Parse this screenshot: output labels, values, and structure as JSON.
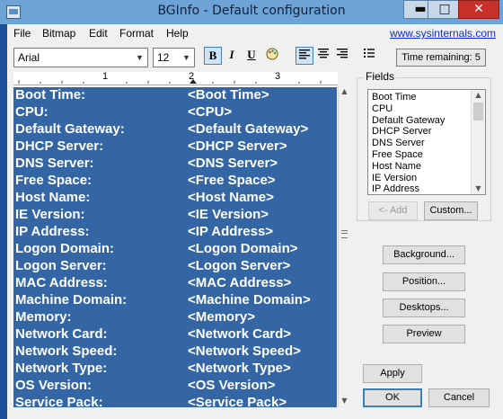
{
  "window": {
    "title": "BGInfo - Default configuration",
    "minimize": "▬",
    "maximize": "□",
    "close": "✕"
  },
  "menu": [
    "File",
    "Bitmap",
    "Edit",
    "Format",
    "Help"
  ],
  "site_link": "www.sysinternals.com",
  "toolbar": {
    "font": "Arial",
    "size": "12",
    "bold": "B",
    "italic": "I",
    "underline": "U",
    "time_remaining": "Time remaining: 5"
  },
  "ruler": {
    "marks": [
      "1",
      "2",
      "3"
    ]
  },
  "editor": {
    "rows": [
      {
        "label": "Boot Time:",
        "value": "<Boot Time>"
      },
      {
        "label": "CPU:",
        "value": "<CPU>"
      },
      {
        "label": "Default Gateway:",
        "value": "<Default Gateway>"
      },
      {
        "label": "DHCP Server:",
        "value": "<DHCP Server>"
      },
      {
        "label": "DNS Server:",
        "value": "<DNS Server>"
      },
      {
        "label": "Free Space:",
        "value": "<Free Space>"
      },
      {
        "label": "Host Name:",
        "value": "<Host Name>"
      },
      {
        "label": "IE Version:",
        "value": "<IE Version>"
      },
      {
        "label": "IP Address:",
        "value": "<IP Address>"
      },
      {
        "label": "Logon Domain:",
        "value": "<Logon Domain>"
      },
      {
        "label": "Logon Server:",
        "value": "<Logon Server>"
      },
      {
        "label": "MAC Address:",
        "value": "<MAC Address>"
      },
      {
        "label": "Machine Domain:",
        "value": "<Machine Domain>"
      },
      {
        "label": "Memory:",
        "value": "<Memory>"
      },
      {
        "label": "Network Card:",
        "value": "<Network Card>"
      },
      {
        "label": "Network Speed:",
        "value": "<Network Speed>"
      },
      {
        "label": "Network Type:",
        "value": "<Network Type>"
      },
      {
        "label": "OS Version:",
        "value": "<OS Version>"
      },
      {
        "label": "Service Pack:",
        "value": "<Service Pack>"
      }
    ]
  },
  "fields": {
    "title": "Fields",
    "items": [
      "Boot Time",
      "CPU",
      "Default Gateway",
      "DHCP Server",
      "DNS Server",
      "Free Space",
      "Host Name",
      "IE Version",
      "IP Address"
    ],
    "add_label": "<- Add",
    "custom_label": "Custom..."
  },
  "buttons": {
    "background": "Background...",
    "position": "Position...",
    "desktops": "Desktops...",
    "preview": "Preview",
    "apply": "Apply",
    "ok": "OK",
    "cancel": "Cancel"
  }
}
